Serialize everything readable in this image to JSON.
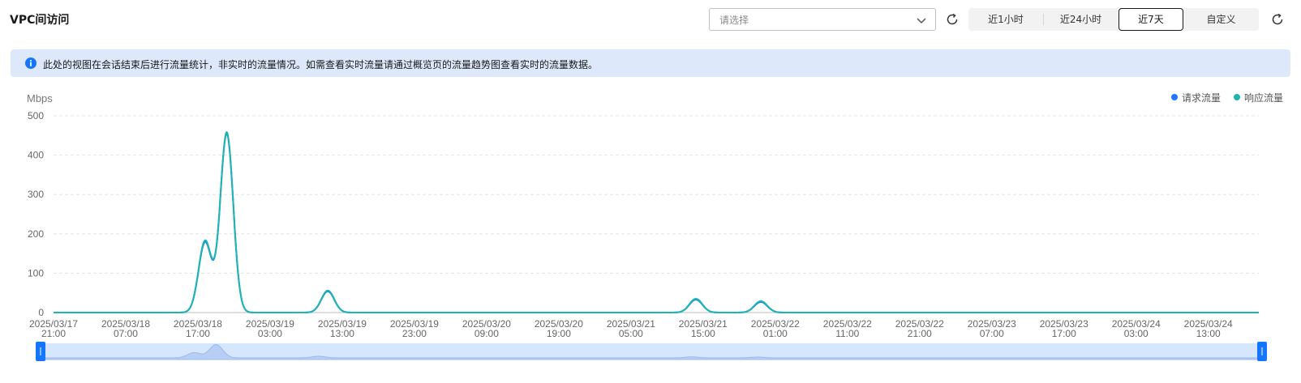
{
  "header": {
    "title": "VPC间访问",
    "select_placeholder": "请选择",
    "time_ranges": [
      "近1小时",
      "近24小时",
      "近7天",
      "自定义"
    ],
    "active_range": "近7天"
  },
  "notice": {
    "text": "此处的视图在会话结束后进行流量统计，非实时的流量情况。如需查看实时流量请通过概览页的流量趋势图查看实时的流量数据。"
  },
  "colors": {
    "accent": "#1476ff",
    "request_series": "#1f77ff",
    "response_series": "#1eb5b0",
    "notice_bg": "#dde9fb"
  },
  "chart_data": {
    "type": "line",
    "ylabel": "Mbps",
    "ylim": [
      0,
      500
    ],
    "yticks": [
      0,
      100,
      200,
      300,
      400,
      500
    ],
    "x_range_hours": [
      0,
      167
    ],
    "x_ticks": [
      {
        "date": "2025/03/17",
        "time": "21:00"
      },
      {
        "date": "2025/03/18",
        "time": "07:00"
      },
      {
        "date": "2025/03/18",
        "time": "17:00"
      },
      {
        "date": "2025/03/19",
        "time": "03:00"
      },
      {
        "date": "2025/03/19",
        "time": "13:00"
      },
      {
        "date": "2025/03/19",
        "time": "23:00"
      },
      {
        "date": "2025/03/20",
        "time": "09:00"
      },
      {
        "date": "2025/03/20",
        "time": "19:00"
      },
      {
        "date": "2025/03/21",
        "time": "05:00"
      },
      {
        "date": "2025/03/21",
        "time": "15:00"
      },
      {
        "date": "2025/03/22",
        "time": "01:00"
      },
      {
        "date": "2025/03/22",
        "time": "11:00"
      },
      {
        "date": "2025/03/22",
        "time": "21:00"
      },
      {
        "date": "2025/03/23",
        "time": "07:00"
      },
      {
        "date": "2025/03/23",
        "time": "17:00"
      },
      {
        "date": "2025/03/24",
        "time": "03:00"
      },
      {
        "date": "2025/03/24",
        "time": "13:00"
      }
    ],
    "grid": true,
    "legend_position": "top-right",
    "series": [
      {
        "name": "请求流量",
        "color": "#1f77ff",
        "peaks": [
          {
            "date": "2025/03/18",
            "time": "18:00",
            "value": 178
          },
          {
            "date": "2025/03/18",
            "time": "21:00",
            "value": 455
          },
          {
            "date": "2025/03/19",
            "time": "11:00",
            "value": 54
          },
          {
            "date": "2025/03/21",
            "time": "14:00",
            "value": 33
          },
          {
            "date": "2025/03/21",
            "time": "23:00",
            "value": 27
          }
        ]
      },
      {
        "name": "响应流量",
        "color": "#1eb5b0",
        "peaks": [
          {
            "date": "2025/03/18",
            "time": "18:00",
            "value": 182
          },
          {
            "date": "2025/03/18",
            "time": "21:00",
            "value": 458
          },
          {
            "date": "2025/03/19",
            "time": "11:00",
            "value": 56
          },
          {
            "date": "2025/03/21",
            "time": "14:00",
            "value": 35
          },
          {
            "date": "2025/03/21",
            "time": "23:00",
            "value": 29
          }
        ]
      }
    ]
  }
}
